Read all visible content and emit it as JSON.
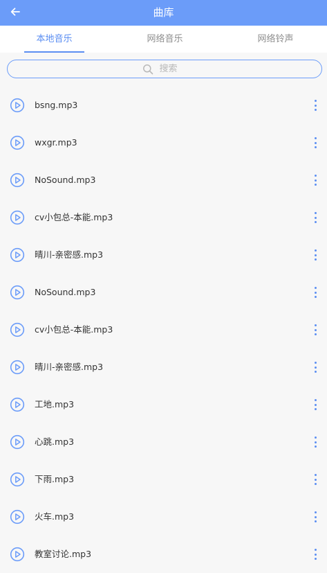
{
  "header": {
    "title": "曲库"
  },
  "tabs": [
    {
      "label": "本地音乐"
    },
    {
      "label": "网络音乐"
    },
    {
      "label": "网络铃声"
    }
  ],
  "search": {
    "placeholder": "搜索"
  },
  "songs": [
    {
      "name": "bsng.mp3"
    },
    {
      "name": "wxgr.mp3"
    },
    {
      "name": "NoSound.mp3"
    },
    {
      "name": "cv小包总-本能.mp3"
    },
    {
      "name": "晴川-亲密感.mp3"
    },
    {
      "name": "NoSound.mp3"
    },
    {
      "name": "cv小包总-本能.mp3"
    },
    {
      "name": "晴川-亲密感.mp3"
    },
    {
      "name": "工地.mp3"
    },
    {
      "name": "心跳.mp3"
    },
    {
      "name": "下雨.mp3"
    },
    {
      "name": "火车.mp3"
    },
    {
      "name": "教室讨论.mp3"
    }
  ],
  "icons": {
    "back": "arrow-left-icon",
    "search": "search-icon",
    "play": "play-circle-icon",
    "more": "more-vertical-icon"
  },
  "colors": {
    "primary": "#6b9cf9",
    "accent": "#5b8ef2",
    "text": "#333333",
    "muted": "#8e8e8e"
  }
}
